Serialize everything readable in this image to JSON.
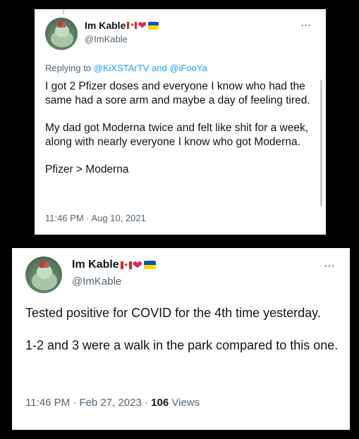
{
  "tweet1": {
    "author_name": "Im Kable",
    "author_handle": "@ImKable",
    "more_label": "···",
    "replying_prefix": "Replying to",
    "replying_user1": "@KiXSTArTV",
    "replying_and": "and",
    "replying_user2": "@iFooYa",
    "paragraphs": [
      "I got 2 Pfizer doses and everyone I know who had the same had a sore arm and maybe a day of feeling tired.",
      "My dad got Moderna twice and felt like shit for a week, along with nearly everyone I know who got Moderna.",
      "Pfizer > Moderna"
    ],
    "timestamp": "11:46 PM · Aug 10, 2021"
  },
  "tweet2": {
    "author_name": "Im Kable",
    "author_handle": "@ImKable",
    "more_label": "···",
    "paragraphs": [
      "Tested positive for COVID for the 4th time yesterday.",
      "1-2 and 3 were a walk in the park compared to this one."
    ],
    "timestamp": "11:46 PM · Feb 27, 2023 ·",
    "views_count": "106",
    "views_label": "Views"
  },
  "icons": {
    "verified_flags": [
      "canada-flag-icon",
      "red-heart-icon",
      "ukraine-flag-icon"
    ],
    "more": "more-options-icon",
    "avatar": "avatar-image"
  },
  "colors": {
    "background": "#000000",
    "card": "#ffffff",
    "link": "#1d9bf0",
    "secondary_text": "#536471",
    "primary_text": "#0f1419",
    "heart": "#e0245e",
    "canada_red": "#d52b1e",
    "ukraine_blue": "#0057b7",
    "ukraine_yellow": "#ffd700"
  }
}
